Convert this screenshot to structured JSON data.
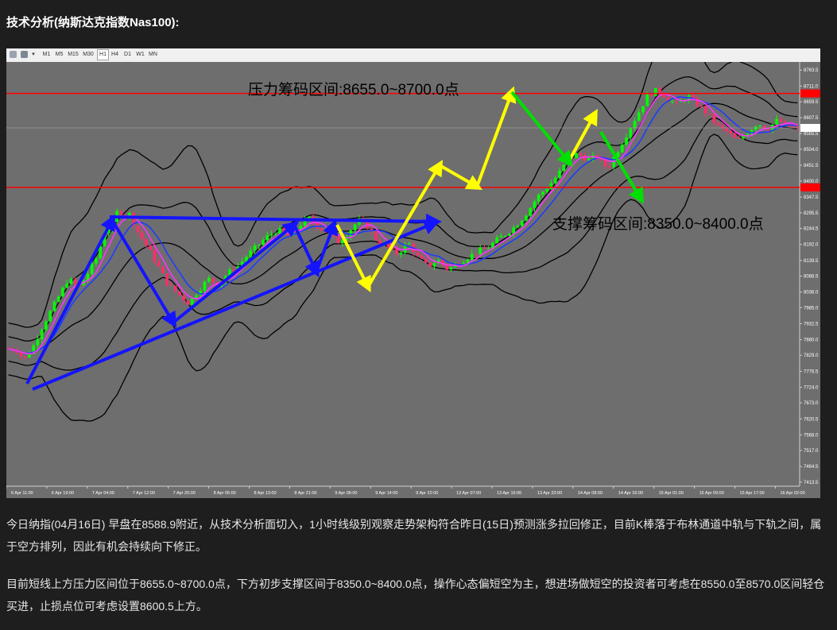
{
  "header": {
    "title": "技术分析(纳斯达克指数Nas100):"
  },
  "toolbar": {
    "timeframes": [
      "M1",
      "M5",
      "M15",
      "M30",
      "H1",
      "H4",
      "D1",
      "W1",
      "MN"
    ],
    "active": "H1"
  },
  "annotations": {
    "resistance": "压力筹码区间:8655.0~8700.0点",
    "support": "支撑筹码区间:8350.0~8400.0点"
  },
  "colors": {
    "background": "#6e6e6e",
    "bull_candle": "#00ff00",
    "bear_candle": "#ff2d6a",
    "bollinger": "#000000",
    "ma_fast": "#ff33ff",
    "ma_slow": "#1e3cff",
    "arrow_blue": "#1414ff",
    "arrow_yellow": "#ffff00",
    "arrow_green": "#00e000",
    "level_line": "#ff0000"
  },
  "chart_data": {
    "type": "candlestick",
    "symbol": "Nas100",
    "timeframe": "H1",
    "y_ticks": [
      8763.5,
      8711.0,
      8659.5,
      8607.5,
      8555.5,
      8504.0,
      8451.5,
      8400.0,
      8347.5,
      8295.5,
      8244.5,
      8192.0,
      8139.5,
      8088.5,
      8036.0,
      7985.0,
      7932.5,
      7880.0,
      7829.0,
      7776.5,
      7724.0,
      7673.0,
      7620.5,
      7568.0,
      7517.0,
      7464.5,
      7413.5
    ],
    "ylim": [
      7400,
      8790
    ],
    "x_ticks": [
      "6 Apr 11:00",
      "6 Apr 19:00",
      "7 Apr 04:00",
      "7 Apr 12:00",
      "7 Apr 20:00",
      "8 Apr 05:00",
      "8 Apr 13:00",
      "8 Apr 21:00",
      "9 Apr 06:00",
      "9 Apr 14:00",
      "9 Apr 22:00",
      "13 Apr 07:00",
      "13 Apr 15:00",
      "13 Apr 23:00",
      "14 Apr 08:00",
      "14 Apr 16:00",
      "15 Apr 01:00",
      "15 Apr 09:00",
      "15 Apr 17:00",
      "16 Apr 02:00"
    ],
    "resistance_level": 8687,
    "support_level": 8379,
    "current_price": 8574.0,
    "price_path": [
      [
        0,
        7850
      ],
      [
        2,
        7846
      ],
      [
        3,
        7810
      ],
      [
        5,
        7860
      ],
      [
        7,
        7930
      ],
      [
        9,
        7990
      ],
      [
        12,
        8080
      ],
      [
        14,
        8050
      ],
      [
        16,
        8100
      ],
      [
        18,
        8160
      ],
      [
        19,
        8230
      ],
      [
        21,
        8260
      ],
      [
        22,
        8310
      ],
      [
        23,
        8280
      ],
      [
        24,
        8300
      ],
      [
        26,
        8230
      ],
      [
        28,
        8180
      ],
      [
        30,
        8120
      ],
      [
        32,
        8060
      ],
      [
        34,
        8030
      ],
      [
        36,
        8000
      ],
      [
        38,
        8040
      ],
      [
        40,
        8080
      ],
      [
        42,
        8060
      ],
      [
        44,
        8100
      ],
      [
        46,
        8120
      ],
      [
        48,
        8160
      ],
      [
        50,
        8190
      ],
      [
        52,
        8220
      ],
      [
        54,
        8240
      ],
      [
        56,
        8220
      ],
      [
        58,
        8250
      ],
      [
        60,
        8280
      ],
      [
        62,
        8250
      ],
      [
        64,
        8230
      ],
      [
        66,
        8200
      ],
      [
        68,
        8230
      ],
      [
        70,
        8270
      ],
      [
        72,
        8250
      ],
      [
        74,
        8200
      ],
      [
        76,
        8180
      ],
      [
        78,
        8160
      ],
      [
        80,
        8200
      ],
      [
        82,
        8150
      ],
      [
        84,
        8120
      ],
      [
        86,
        8140
      ],
      [
        88,
        8110
      ],
      [
        90,
        8130
      ],
      [
        92,
        8150
      ],
      [
        94,
        8170
      ],
      [
        96,
        8180
      ],
      [
        98,
        8210
      ],
      [
        100,
        8230
      ],
      [
        102,
        8260
      ],
      [
        104,
        8300
      ],
      [
        106,
        8350
      ],
      [
        108,
        8380
      ],
      [
        110,
        8420
      ],
      [
        112,
        8470
      ],
      [
        114,
        8490
      ],
      [
        116,
        8470
      ],
      [
        118,
        8480
      ],
      [
        120,
        8440
      ],
      [
        122,
        8500
      ],
      [
        124,
        8560
      ],
      [
        126,
        8620
      ],
      [
        128,
        8680
      ],
      [
        130,
        8700
      ],
      [
        132,
        8670
      ],
      [
        134,
        8650
      ],
      [
        136,
        8680
      ],
      [
        138,
        8650
      ],
      [
        140,
        8620
      ],
      [
        142,
        8580
      ],
      [
        144,
        8560
      ],
      [
        146,
        8530
      ],
      [
        148,
        8560
      ],
      [
        150,
        8590
      ],
      [
        152,
        8570
      ],
      [
        154,
        8600
      ],
      [
        156,
        8580
      ],
      [
        158,
        8570
      ]
    ]
  },
  "paragraphs": [
    "今日纳指(04月16日) 早盘在8588.9附近，从技术分析面切入，1小时线级别观察走势架构符合昨日(15日)预测涨多拉回修正，目前K棒落于布林通道中轨与下轨之间，属于空方排列，因此有机会持续向下修正。",
    "目前短线上方压力区间位于8655.0~8700.0点，下方初步支撑区间于8350.0~8400.0点，操作心态偏短空为主，想进场做短空的投资者可考虑在8550.0至8570.0区间轻仓买进，止损点位可考虑设置8600.5上方。"
  ]
}
